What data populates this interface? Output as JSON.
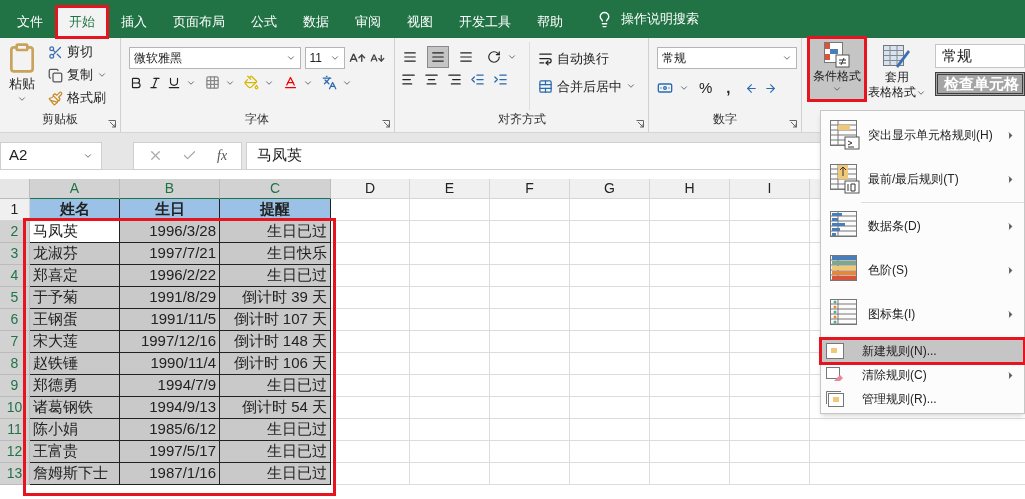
{
  "tabs": [
    {
      "label": "文件",
      "selected": false,
      "annotated": false
    },
    {
      "label": "开始",
      "selected": true,
      "annotated": true
    },
    {
      "label": "插入",
      "selected": false,
      "annotated": false
    },
    {
      "label": "页面布局",
      "selected": false,
      "annotated": false
    },
    {
      "label": "公式",
      "selected": false,
      "annotated": false
    },
    {
      "label": "数据",
      "selected": false,
      "annotated": false
    },
    {
      "label": "审阅",
      "selected": false,
      "annotated": false
    },
    {
      "label": "视图",
      "selected": false,
      "annotated": false
    },
    {
      "label": "开发工具",
      "selected": false,
      "annotated": false
    },
    {
      "label": "帮助",
      "selected": false,
      "annotated": false
    }
  ],
  "tell_me": "操作说明搜索",
  "ribbon": {
    "clipboard": {
      "paste": "粘贴",
      "cut": "剪切",
      "copy": "复制",
      "format_painter": "格式刷",
      "label": "剪贴板"
    },
    "font": {
      "name": "微软雅黑",
      "size": "11",
      "label": "字体"
    },
    "alignment": {
      "vertical_buttons": [
        {
          "selected": false
        },
        {
          "selected": true
        },
        {
          "selected": false
        }
      ],
      "wrap": "自动换行",
      "merge": "合并后居中",
      "label": "对齐方式"
    },
    "number": {
      "format": "常规",
      "percent": "%",
      "comma": ",",
      "label": "数字"
    },
    "styles": {
      "conditional_formatting": {
        "label": "条件格式",
        "pressed": true,
        "annotated": true
      },
      "format_as_table": {
        "line1": "套用",
        "line2": "表格格式"
      },
      "cell_styles": [
        {
          "label": "常规",
          "kind": "normal"
        },
        {
          "label": "检查单元格",
          "kind": "check"
        }
      ]
    }
  },
  "formula_bar": {
    "name_box": "A2",
    "fx": "fx",
    "value": "马凤英"
  },
  "sheet": {
    "columns": [
      "A",
      "B",
      "C",
      "D",
      "E",
      "F",
      "G",
      "H",
      "I"
    ],
    "range_annotated": true,
    "rows": [
      {
        "number": "1",
        "kind": "header",
        "cells": [
          "姓名",
          "生日",
          "提醒"
        ]
      },
      {
        "number": "2",
        "kind": "data",
        "active": true,
        "cells": [
          "马凤英",
          "1996/3/28",
          "生日已过"
        ]
      },
      {
        "number": "3",
        "kind": "data",
        "active": false,
        "cells": [
          "龙淑芬",
          "1997/7/21",
          "生日快乐"
        ]
      },
      {
        "number": "4",
        "kind": "data",
        "active": false,
        "cells": [
          "郑喜定",
          "1996/2/22",
          "生日已过"
        ]
      },
      {
        "number": "5",
        "kind": "data",
        "active": false,
        "cells": [
          "于予菊",
          "1991/8/29",
          "倒计时 39 天"
        ]
      },
      {
        "number": "6",
        "kind": "data",
        "active": false,
        "cells": [
          "王钢蛋",
          "1991/11/5",
          "倒计时 107 天"
        ]
      },
      {
        "number": "7",
        "kind": "data",
        "active": false,
        "cells": [
          "宋大莲",
          "1997/12/16",
          "倒计时 148 天"
        ]
      },
      {
        "number": "8",
        "kind": "data",
        "active": false,
        "cells": [
          "赵铁锤",
          "1990/11/4",
          "倒计时 106 天"
        ]
      },
      {
        "number": "9",
        "kind": "data",
        "active": false,
        "cells": [
          "郑德勇",
          "1994/7/9",
          "生日已过"
        ]
      },
      {
        "number": "10",
        "kind": "data",
        "active": false,
        "cells": [
          "诸葛钢铁",
          "1994/9/13",
          "倒计时 54 天"
        ]
      },
      {
        "number": "11",
        "kind": "data",
        "active": false,
        "cells": [
          "陈小娟",
          "1985/6/12",
          "生日已过"
        ]
      },
      {
        "number": "12",
        "kind": "data",
        "active": false,
        "cells": [
          "王富贵",
          "1997/5/17",
          "生日已过"
        ]
      },
      {
        "number": "13",
        "kind": "data",
        "active": false,
        "cells": [
          "詹姆斯下士",
          "1987/1/16",
          "生日已过"
        ]
      }
    ]
  },
  "menu": {
    "items": [
      {
        "label": "突出显示单元格规则(H)",
        "kind": "large",
        "submenu": true,
        "highlighted": false,
        "annotated": false,
        "separator_after": false
      },
      {
        "label": "最前/最后规则(T)",
        "kind": "large",
        "submenu": true,
        "highlighted": false,
        "annotated": false,
        "separator_after": true
      },
      {
        "label": "数据条(D)",
        "kind": "large",
        "submenu": true,
        "highlighted": false,
        "annotated": false,
        "separator_after": false
      },
      {
        "label": "色阶(S)",
        "kind": "large",
        "submenu": true,
        "highlighted": false,
        "annotated": false,
        "separator_after": false
      },
      {
        "label": "图标集(I)",
        "kind": "large",
        "submenu": true,
        "highlighted": false,
        "annotated": false,
        "separator_after": true
      },
      {
        "label": "新建规则(N)...",
        "kind": "small",
        "submenu": false,
        "highlighted": true,
        "annotated": true,
        "separator_after": false
      },
      {
        "label": "清除规则(C)",
        "kind": "small",
        "submenu": true,
        "highlighted": false,
        "annotated": false,
        "separator_after": false
      },
      {
        "label": "管理规则(R)...",
        "kind": "small",
        "submenu": false,
        "highlighted": false,
        "annotated": false
      }
    ]
  }
}
